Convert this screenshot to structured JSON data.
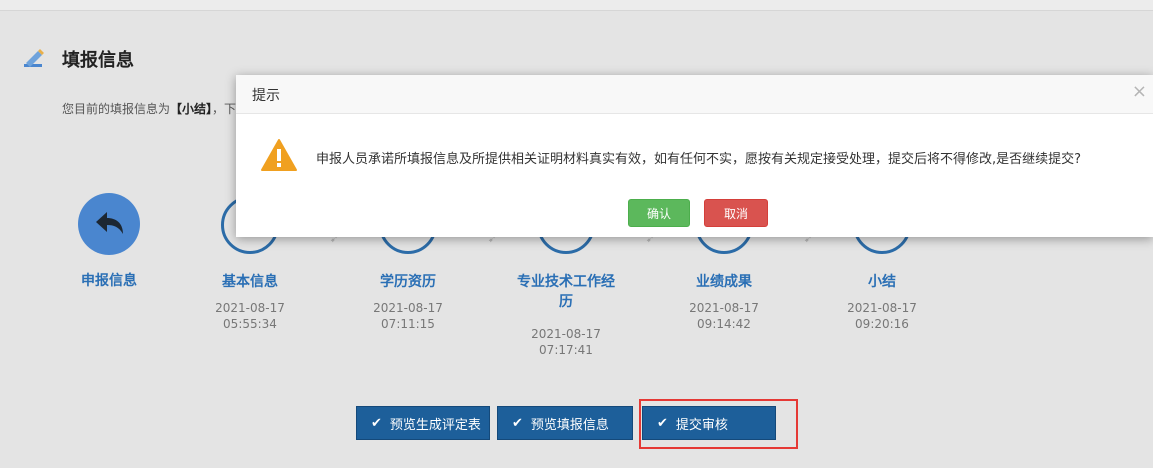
{
  "page": {
    "title": "填报信息",
    "info_prefix": "您目前的填报信息为",
    "info_current": "【小结】",
    "info_suffix": "，下"
  },
  "steps": [
    {
      "name": "申报信息",
      "date": "",
      "time": ""
    },
    {
      "name": "基本信息",
      "date": "2021-08-17",
      "time": "05:55:34"
    },
    {
      "name": "学历资历",
      "date": "2021-08-17",
      "time": "07:11:15"
    },
    {
      "name": "专业技术工作经历",
      "date": "2021-08-17",
      "time": "07:17:41"
    },
    {
      "name": "业绩成果",
      "date": "2021-08-17",
      "time": "09:14:42"
    },
    {
      "name": "小结",
      "date": "2021-08-17",
      "time": "09:20:16"
    }
  ],
  "steps_name_line1_3": "专业技术工作经",
  "steps_name_line2_3": "历",
  "buttons": {
    "preview_form": "预览生成评定表",
    "preview_info": "预览填报信息",
    "submit_review": "提交审核"
  },
  "modal": {
    "title": "提示",
    "close": "×",
    "message": "申报人员承诺所填报信息及所提供相关证明材料真实有效，如有任何不实，愿按有关规定接受处理，提交后将不得修改,是否继续提交?",
    "confirm": "确认",
    "cancel": "取消"
  },
  "colors": {
    "primary": "#2c6ca8",
    "button": "#1d5f9a",
    "confirm": "#5cb85c",
    "cancel": "#d9534f",
    "highlight": "#e53935",
    "warning": "#f0a020"
  }
}
